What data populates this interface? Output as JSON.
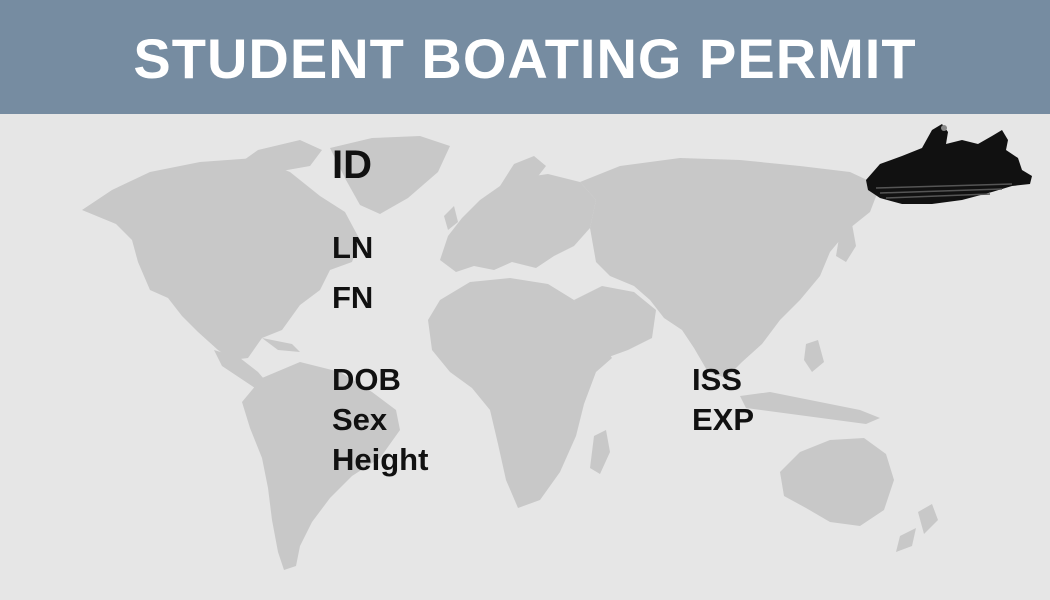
{
  "header": {
    "title": "STUDENT BOATING PERMIT"
  },
  "fields": {
    "id": "ID",
    "last_name": "LN",
    "first_name": "FN",
    "dob": "DOB",
    "sex": "Sex",
    "height": "Height",
    "issued": "ISS",
    "expires": "EXP"
  },
  "icons": {
    "watercraft": "jet-ski-icon",
    "background": "world-map"
  },
  "colors": {
    "header_bg": "#768ca1",
    "card_bg": "#e6e6e6",
    "map": "#c8c8c8",
    "text": "#111111"
  }
}
